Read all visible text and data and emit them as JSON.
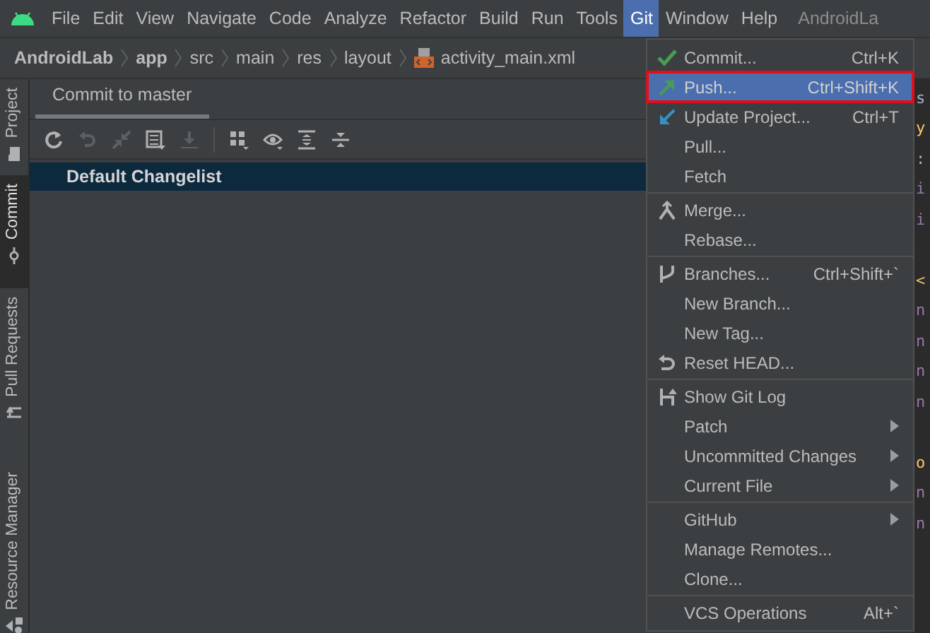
{
  "menu_bar": {
    "items": [
      {
        "label": "File",
        "selected": false
      },
      {
        "label": "Edit",
        "selected": false
      },
      {
        "label": "View",
        "selected": false
      },
      {
        "label": "Navigate",
        "selected": false
      },
      {
        "label": "Code",
        "selected": false
      },
      {
        "label": "Analyze",
        "selected": false
      },
      {
        "label": "Refactor",
        "selected": false
      },
      {
        "label": "Build",
        "selected": false
      },
      {
        "label": "Run",
        "selected": false
      },
      {
        "label": "Tools",
        "selected": false
      },
      {
        "label": "Git",
        "selected": true
      },
      {
        "label": "Window",
        "selected": false
      },
      {
        "label": "Help",
        "selected": false
      }
    ],
    "window_title": "AndroidLa"
  },
  "breadcrumb": [
    {
      "label": "AndroidLab",
      "bold": true,
      "kind": "folder"
    },
    {
      "label": "app",
      "bold": true,
      "kind": "folder"
    },
    {
      "label": "src",
      "bold": false,
      "kind": "folder"
    },
    {
      "label": "main",
      "bold": false,
      "kind": "folder"
    },
    {
      "label": "res",
      "bold": false,
      "kind": "folder"
    },
    {
      "label": "layout",
      "bold": false,
      "kind": "folder"
    },
    {
      "label": "activity_main.xml",
      "bold": false,
      "kind": "file"
    }
  ],
  "tool_strip": [
    {
      "label": "Project",
      "selected": false
    },
    {
      "label": "Commit",
      "selected": true
    },
    {
      "label": "Pull Requests",
      "selected": false
    },
    {
      "label": "Resource Manager",
      "selected": false
    }
  ],
  "commit_panel": {
    "tab": "Commit to master",
    "toolbar": [
      {
        "kind": "button",
        "disabled": false
      },
      {
        "kind": "button",
        "disabled": true
      },
      {
        "kind": "button",
        "disabled": true
      },
      {
        "kind": "button",
        "disabled": false
      },
      {
        "kind": "button",
        "disabled": true
      },
      {
        "kind": "separator"
      },
      {
        "kind": "button",
        "disabled": false
      },
      {
        "kind": "button",
        "disabled": false
      },
      {
        "kind": "button",
        "disabled": false
      },
      {
        "kind": "button",
        "disabled": false
      }
    ],
    "changelists": [
      {
        "label": "Default Changelist",
        "selected": true
      }
    ]
  },
  "editor_lines": [
    {
      "text": "s",
      "color": "#a9b7c6"
    },
    {
      "text": "y",
      "color": "#ffc66d"
    },
    {
      "text": ":",
      "color": "#a9b7c6"
    },
    {
      "text": "i",
      "color": "#9876aa"
    },
    {
      "text": "i",
      "color": "#9876aa"
    },
    {
      "kind": "blank"
    },
    {
      "text": "<",
      "color": "#e8bf6a"
    },
    {
      "text": "n",
      "color": "#9876aa"
    },
    {
      "text": "n",
      "color": "#9876aa"
    },
    {
      "text": "n",
      "color": "#9876aa"
    },
    {
      "text": "n",
      "color": "#9876aa"
    },
    {
      "kind": "blank"
    },
    {
      "text": "o",
      "color": "#ffc66d"
    },
    {
      "text": "n",
      "color": "#9876aa"
    },
    {
      "text": "n",
      "color": "#9876aa"
    }
  ],
  "git_menu": [
    {
      "kind": "item",
      "label": "Commit...",
      "shortcut": "Ctrl+K",
      "submenu": false,
      "selected": false
    },
    {
      "kind": "item",
      "label": "Push...",
      "shortcut": "Ctrl+Shift+K",
      "submenu": false,
      "selected": true
    },
    {
      "kind": "item",
      "label": "Update Project...",
      "shortcut": "Ctrl+T",
      "submenu": false,
      "selected": false
    },
    {
      "kind": "item",
      "label": "Pull...",
      "submenu": false,
      "selected": false
    },
    {
      "kind": "item",
      "label": "Fetch",
      "submenu": false,
      "selected": false
    },
    {
      "kind": "separator"
    },
    {
      "kind": "item",
      "label": "Merge...",
      "submenu": false,
      "selected": false
    },
    {
      "kind": "item",
      "label": "Rebase...",
      "submenu": false,
      "selected": false
    },
    {
      "kind": "separator"
    },
    {
      "kind": "item",
      "label": "Branches...",
      "shortcut": "Ctrl+Shift+`",
      "submenu": false,
      "selected": false
    },
    {
      "kind": "item",
      "label": "New Branch...",
      "submenu": false,
      "selected": false
    },
    {
      "kind": "item",
      "label": "New Tag...",
      "submenu": false,
      "selected": false
    },
    {
      "kind": "item",
      "label": "Reset HEAD...",
      "submenu": false,
      "selected": false
    },
    {
      "kind": "separator"
    },
    {
      "kind": "item",
      "label": "Show Git Log",
      "submenu": false,
      "selected": false
    },
    {
      "kind": "item",
      "label": "Patch",
      "submenu": true,
      "selected": false
    },
    {
      "kind": "item",
      "label": "Uncommitted Changes",
      "submenu": true,
      "selected": false
    },
    {
      "kind": "item",
      "label": "Current File",
      "submenu": true,
      "selected": false
    },
    {
      "kind": "separator"
    },
    {
      "kind": "item",
      "label": "GitHub",
      "submenu": true,
      "selected": false
    },
    {
      "kind": "item",
      "label": "Manage Remotes...",
      "submenu": false,
      "selected": false
    },
    {
      "kind": "item",
      "label": "Clone...",
      "submenu": false,
      "selected": false
    },
    {
      "kind": "separator"
    },
    {
      "kind": "item",
      "label": "VCS Operations",
      "shortcut": "Alt+`",
      "submenu": false,
      "selected": false
    }
  ]
}
